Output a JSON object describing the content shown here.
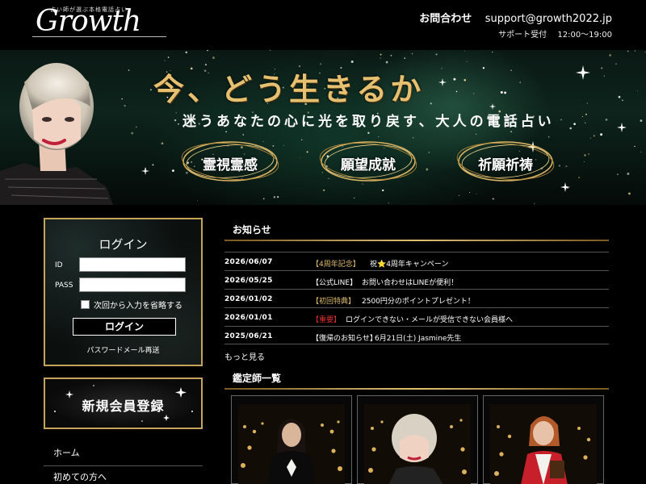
{
  "header": {
    "logo_tagline": "占い師が選ぶ本格電話占い",
    "logo_text": "Growth",
    "contact_label": "お問合わせ",
    "contact_email": "support@growth2022.jp",
    "support_label": "サポート受付",
    "support_hours": "12:00～19:00"
  },
  "hero": {
    "title": "今、どう生きるか",
    "subtitle": "迷うあなたの心に光を取り戻す、大人の電話占い",
    "badges": [
      "霊視霊感",
      "願望成就",
      "祈願祈祷"
    ]
  },
  "login": {
    "title": "ログイン",
    "id_label": "ID",
    "pass_label": "PASS",
    "remember_label": "次回から入力を省略する",
    "button_label": "ログイン",
    "password_reset_link": "パスワードメール再送"
  },
  "register": {
    "label": "新規会員登録"
  },
  "nav": {
    "items": [
      "ホーム",
      "初めての方へ"
    ]
  },
  "news": {
    "title": "お知らせ",
    "items": [
      {
        "date": "2026/06/07",
        "tag": "【4周年記念】",
        "tag_color": "#e2bf6e",
        "text": "祝⭐4周年キャンペーン"
      },
      {
        "date": "2026/05/25",
        "tag": "【公式LINE】",
        "tag_color": "#ffffff",
        "text": "お問い合わせはLINEが便利！"
      },
      {
        "date": "2026/01/02",
        "tag": "【初回特典】",
        "tag_color": "#e2bf6e",
        "text": "2500円分のポイントプレゼント！"
      },
      {
        "date": "2026/01/01",
        "tag": "【重要】",
        "tag_color": "#e03030",
        "text": "ログインできない・メールが受信できない会員様へ"
      },
      {
        "date": "2025/06/21",
        "tag": "【復帰のお知らせ】",
        "tag_color": "#ffffff",
        "text": "6月21日(土) Jasmine先生"
      }
    ],
    "more_label": "もっと見る"
  },
  "advisors": {
    "title": "鑑定師一覧"
  },
  "colors": {
    "gold": "#c5a35b",
    "gold_light": "#e6c071",
    "background": "#000000"
  }
}
